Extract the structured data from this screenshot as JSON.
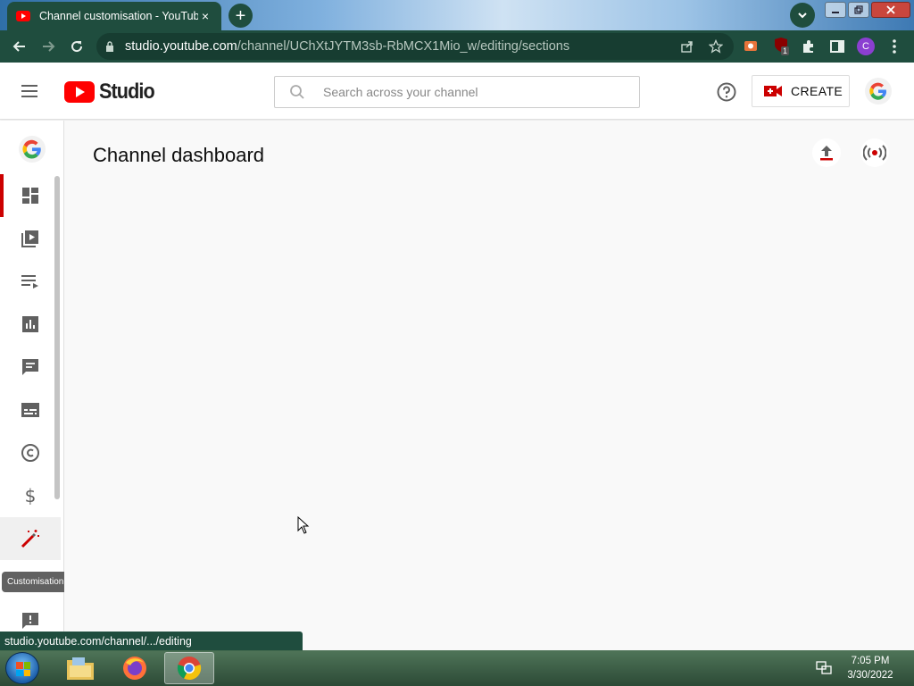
{
  "browser": {
    "tab_title": "Channel customisation - YouTube Studio",
    "tab_close": "×",
    "new_tab": "+",
    "url_host": "studio.youtube.com",
    "url_path": "/channel/UChXtJYTM3sb-RbMCX1Mio_w/editing/sections",
    "profile_initial": "C",
    "extension_badge": "1",
    "status_url": "studio.youtube.com/channel/.../editing"
  },
  "header": {
    "logo_text": "Studio",
    "search_placeholder": "Search across your channel",
    "create_label": "CREATE"
  },
  "sidenav": {
    "items": [
      {
        "name": "dashboard",
        "icon": "dashboard-icon",
        "active": true
      },
      {
        "name": "content",
        "icon": "video-library-icon"
      },
      {
        "name": "playlists",
        "icon": "playlist-icon"
      },
      {
        "name": "analytics",
        "icon": "analytics-icon"
      },
      {
        "name": "comments",
        "icon": "comment-icon"
      },
      {
        "name": "subtitles",
        "icon": "subtitles-icon"
      },
      {
        "name": "copyright",
        "icon": "copyright-icon"
      },
      {
        "name": "monetisation",
        "icon": "dollar-icon"
      },
      {
        "name": "customisation",
        "icon": "magic-wand-icon",
        "hovered": true
      },
      {
        "name": "feedback",
        "icon": "feedback-icon"
      }
    ],
    "tooltip": "Customisation"
  },
  "main": {
    "page_title": "Channel dashboard"
  },
  "taskbar": {
    "time": "7:05 PM",
    "date": "3/30/2022"
  },
  "colors": {
    "brand_red": "#ff0000",
    "active_red": "#cc0000",
    "chrome_green": "#1f4d3e"
  }
}
